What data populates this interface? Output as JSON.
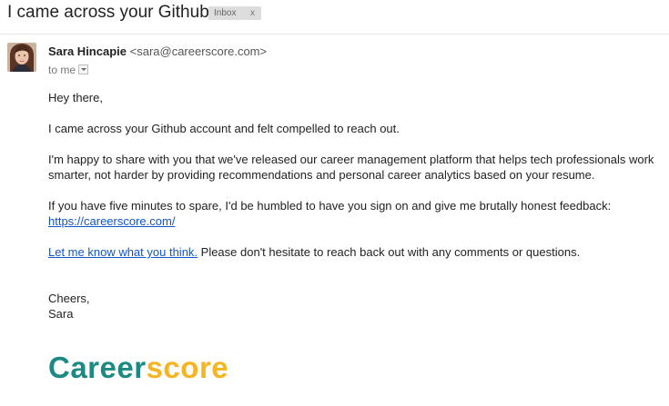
{
  "email": {
    "subject": "I came across your Github",
    "label": {
      "text": "Inbox",
      "remove": "x"
    },
    "sender": {
      "name": "Sara Hincapie",
      "email": "<sara@careerscore.com>",
      "to": "to me"
    },
    "body": {
      "greeting": "Hey there,",
      "p1": "I came across your Github account and felt compelled to reach out.",
      "p2": "I'm happy to share with you that we've released our career management platform that helps tech professionals work smarter, not harder by providing recommendations and personal career analytics based on your resume.",
      "p3_text": "If you have five minutes to spare, I'd be humbled to have you sign on and give me brutally honest feedback: ",
      "p3_link": "https://careerscore.com/",
      "p4_link": "Let me know what you think.",
      "p4_text": " Please don't hesitate to reach back out with any comments or questions.",
      "signoff": "Cheers,",
      "signature": "Sara"
    },
    "logo": {
      "part1": "Career",
      "part2": "score"
    }
  },
  "colors": {
    "link": "#1155cc",
    "logo_teal": "#1a8a83",
    "logo_gold": "#f5b422",
    "label_bg": "#dddddd"
  }
}
